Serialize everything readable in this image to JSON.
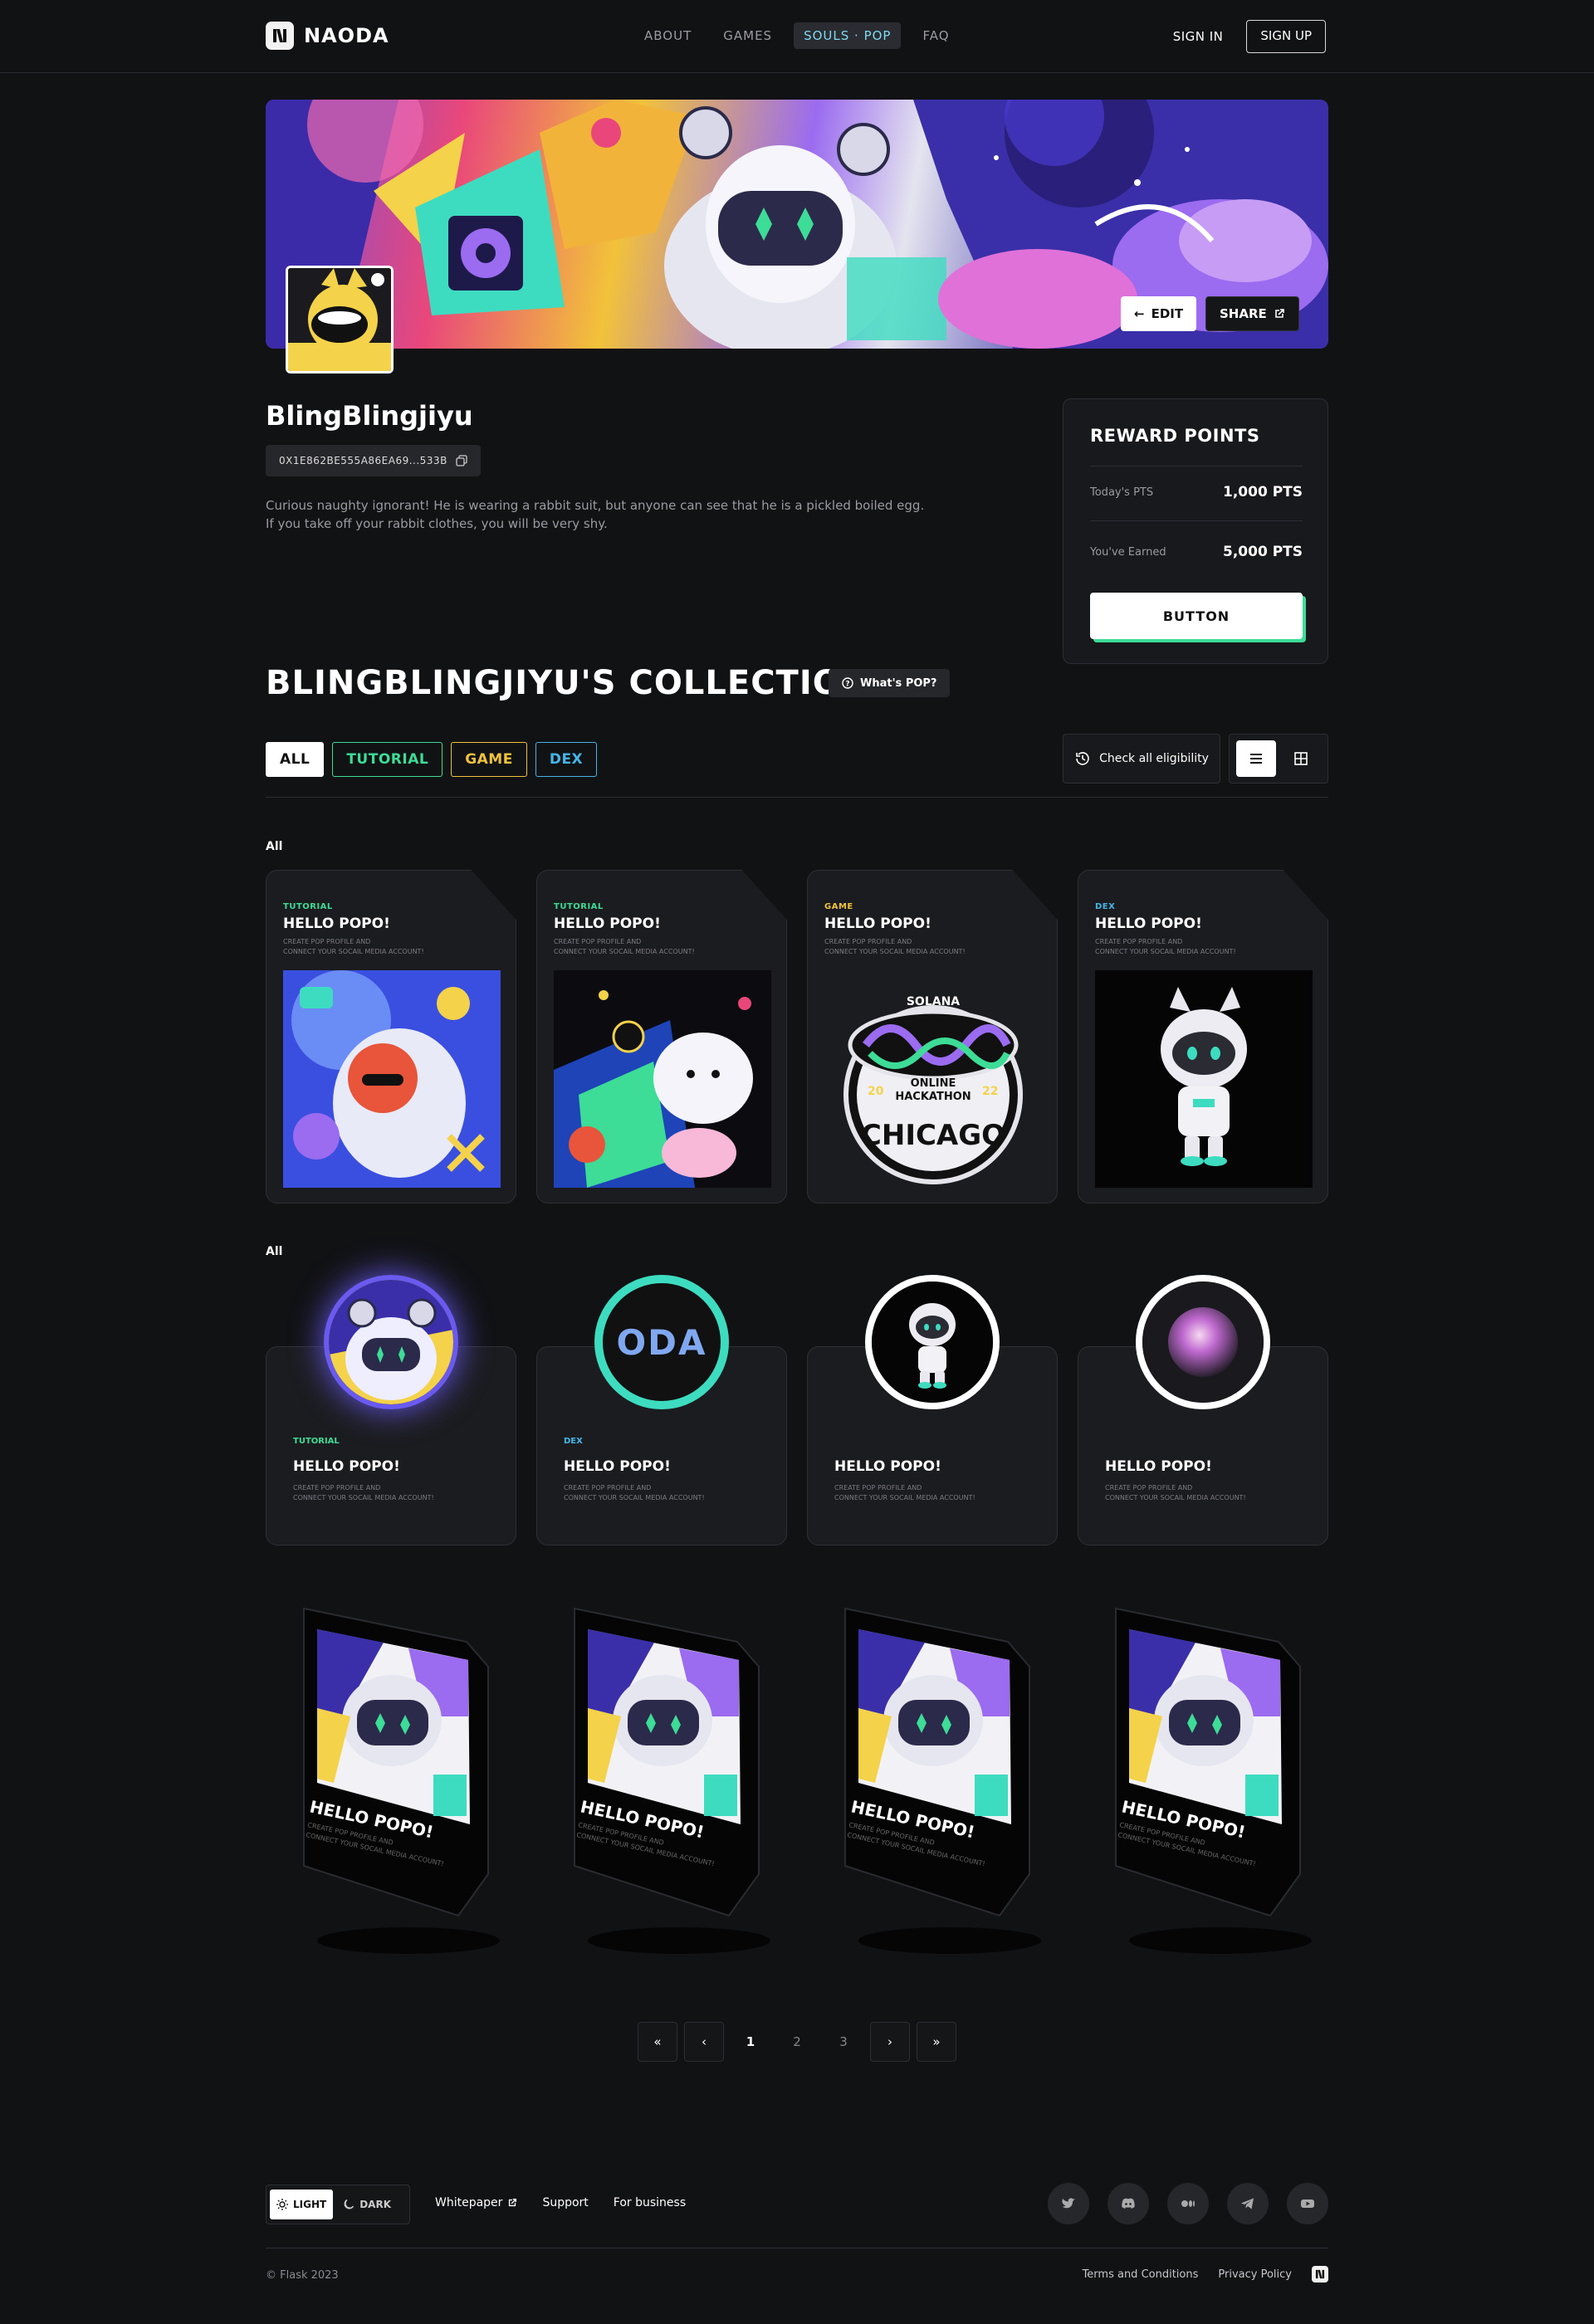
{
  "header": {
    "brand": "NAODA",
    "nav": [
      "ABOUT",
      "GAMES",
      "SOULS · POP",
      "FAQ"
    ],
    "sign_in": "SIGN IN",
    "sign_up": "SIGN UP"
  },
  "banner": {
    "edit_label": "EDIT",
    "share_label": "SHARE"
  },
  "profile": {
    "name": "BlingBlingjiyu",
    "address": "0X1E862BE555A86EA69...533B",
    "bio_line1": "Curious naughty ignorant! He is wearing a rabbit suit, but anyone can see that he is a pickled boiled egg.",
    "bio_line2": "If you take off your rabbit clothes, you will be very shy."
  },
  "reward": {
    "title": "REWARD POINTS",
    "today_label": "Today's PTS",
    "today_value": "1,000 PTS",
    "earned_label": "You've Earned",
    "earned_value": "5,000 PTS",
    "button": "BUTTON"
  },
  "collection": {
    "title": "BLINGBLINGJIYU'S COLLECTION",
    "whats_pop": "What's POP?",
    "filters": [
      "ALL",
      "TUTORIAL",
      "GAME",
      "DEX"
    ],
    "check_all": "Check all eligibility",
    "section_label_1": "All",
    "section_label_2": "All",
    "row1": [
      {
        "tag": "TUTORIAL",
        "title": "HELLO POPO!",
        "desc1": "CREATE POP PROFILE AND",
        "desc2": "CONNECT YOUR SOCAIL MEDIA ACCOUNT!"
      },
      {
        "tag": "TUTORIAL",
        "title": "HELLO POPO!",
        "desc1": "CREATE POP PROFILE AND",
        "desc2": "CONNECT YOUR SOCAIL MEDIA ACCOUNT!"
      },
      {
        "tag": "GAME",
        "title": "HELLO POPO!",
        "desc1": "CREATE POP PROFILE AND",
        "desc2": "CONNECT YOUR SOCAIL MEDIA ACCOUNT!"
      },
      {
        "tag": "DEX",
        "title": "HELLO POPO!",
        "desc1": "CREATE POP PROFILE AND",
        "desc2": "CONNECT YOUR SOCAIL MEDIA ACCOUNT!"
      }
    ],
    "hackathon": {
      "l1": "SOLANA",
      "l2": "ONLINE",
      "l3": "HACKATHON",
      "l4": "CHICAGO",
      "y1": "20",
      "y2": "22"
    },
    "row2": [
      {
        "tag": "TUTORIAL",
        "title": "HELLO POPO!",
        "desc1": "CREATE POP PROFILE AND",
        "desc2": "CONNECT YOUR SOCAIL MEDIA ACCOUNT!"
      },
      {
        "tag": "DEX",
        "title": "HELLO POPO!",
        "desc1": "CREATE POP PROFILE AND",
        "desc2": "CONNECT YOUR SOCAIL MEDIA ACCOUNT!"
      },
      {
        "tag": "",
        "title": "HELLO POPO!",
        "desc1": "CREATE POP PROFILE AND",
        "desc2": "CONNECT YOUR SOCAIL MEDIA ACCOUNT!"
      },
      {
        "tag": "",
        "title": "HELLO POPO!",
        "desc1": "CREATE POP PROFILE AND",
        "desc2": "CONNECT YOUR SOCAIL MEDIA ACCOUNT!"
      }
    ],
    "oda_badge": "ODA",
    "row3": [
      {
        "title": "HELLO POPO!",
        "desc1": "CREATE POP PROFILE AND",
        "desc2": "CONNECT YOUR SOCAIL MEDIA ACCOUNT!"
      },
      {
        "title": "HELLO POPO!",
        "desc1": "CREATE POP PROFILE AND",
        "desc2": "CONNECT YOUR SOCAIL MEDIA ACCOUNT!"
      },
      {
        "title": "HELLO POPO!",
        "desc1": "CREATE POP PROFILE AND",
        "desc2": "CONNECT YOUR SOCAIL MEDIA ACCOUNT!"
      },
      {
        "title": "HELLO POPO!",
        "desc1": "CREATE POP PROFILE AND",
        "desc2": "CONNECT YOUR SOCAIL MEDIA ACCOUNT!"
      }
    ]
  },
  "pagination": {
    "pages": [
      "1",
      "2",
      "3"
    ],
    "current": "1"
  },
  "footer": {
    "light": "LIGHT",
    "dark": "DARK",
    "links": [
      "Whitepaper",
      "Support",
      "For business"
    ],
    "socials": [
      "twitter-icon",
      "discord-icon",
      "medium-icon",
      "telegram-icon",
      "youtube-icon"
    ],
    "copyright": "© Flask 2023",
    "terms": "Terms and Conditions",
    "privacy": "Privacy Policy"
  },
  "colors": {
    "tutorial": "#3ddc97",
    "game": "#f0c33c",
    "dex": "#44b6e8",
    "accent_nav": "#7fd9f0"
  }
}
